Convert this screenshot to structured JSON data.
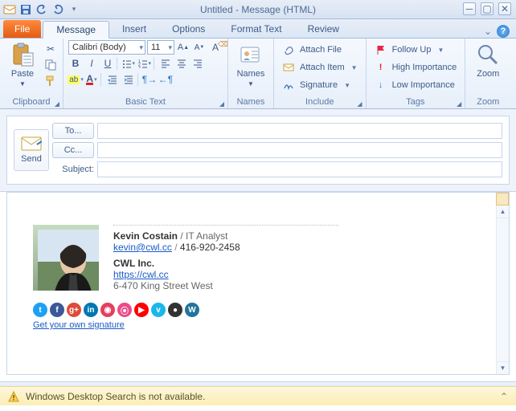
{
  "window": {
    "title": "Untitled - Message (HTML)"
  },
  "tabs": {
    "file": "File",
    "items": [
      "Message",
      "Insert",
      "Options",
      "Format Text",
      "Review"
    ],
    "activeIndex": 0
  },
  "ribbon": {
    "clipboard": {
      "label": "Clipboard",
      "paste": "Paste"
    },
    "basictext": {
      "label": "Basic Text",
      "font": "Calibri (Body)",
      "size": "11"
    },
    "names": {
      "label": "Names",
      "btn": "Names"
    },
    "include": {
      "label": "Include",
      "attach_file": "Attach File",
      "attach_item": "Attach Item",
      "signature": "Signature"
    },
    "tags": {
      "label": "Tags",
      "follow_up": "Follow Up",
      "high": "High Importance",
      "low": "Low Importance"
    },
    "zoom": {
      "label": "Zoom",
      "btn": "Zoom"
    }
  },
  "header": {
    "send": "Send",
    "to": "To...",
    "cc": "Cc...",
    "subject": "Subject:",
    "to_val": "",
    "cc_val": "",
    "subject_val": ""
  },
  "signature": {
    "name": "Kevin Costain",
    "role": "IT Analyst",
    "email": "kevin@cwl.cc",
    "phone": "416-920-2458",
    "company": "CWL Inc.",
    "url": "https://cwl.cc",
    "address": "6-470 King Street West",
    "getyourown": "Get your own signature",
    "social_colors": [
      "#1da1f2",
      "#3b5998",
      "#dd4b39",
      "#0077b5",
      "#e4405f",
      "#ea4c89",
      "#ff0000",
      "#1ab7ea",
      "#333333",
      "#21759b"
    ]
  },
  "sep": " / ",
  "status": {
    "text": "Windows Desktop Search is not available."
  }
}
